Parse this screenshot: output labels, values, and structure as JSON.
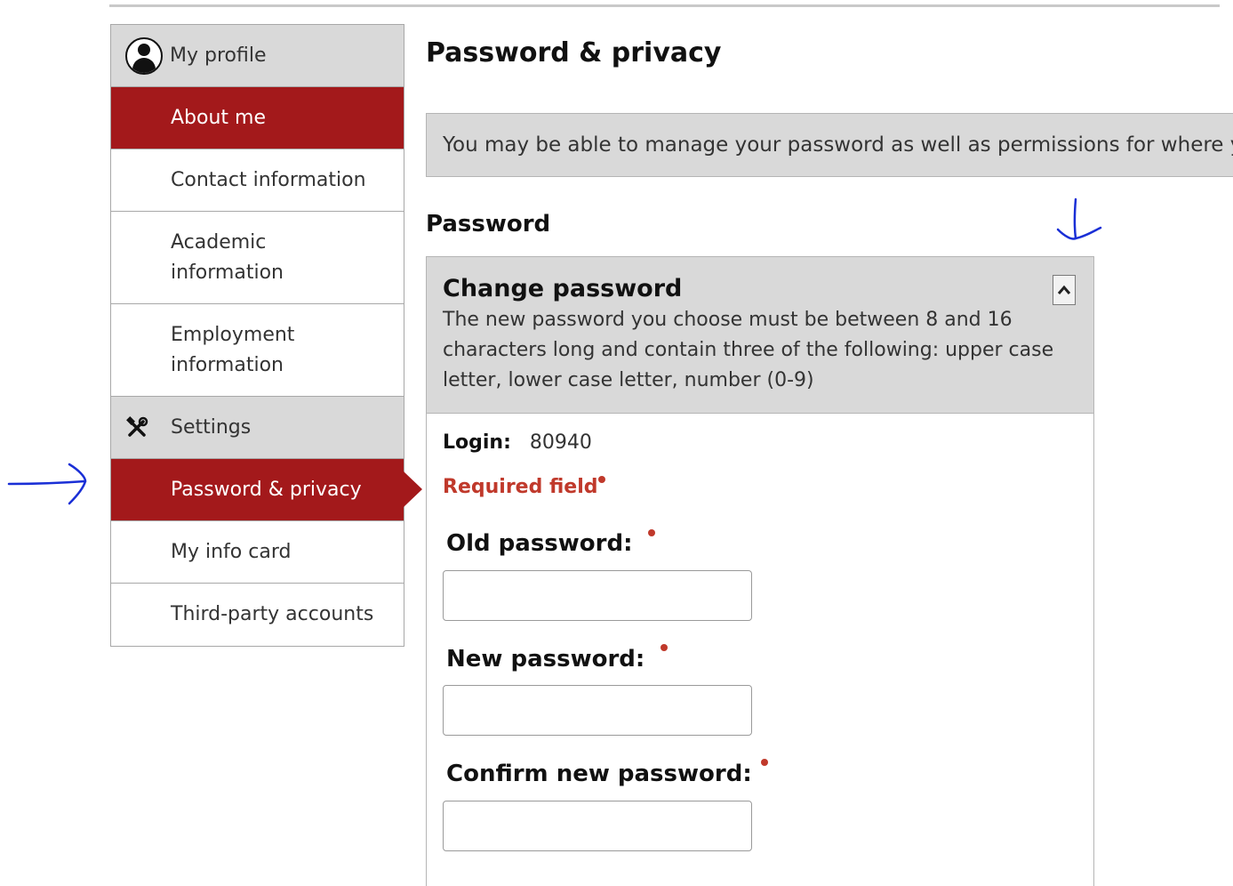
{
  "sidebar": {
    "profile_label": "My profile",
    "items": [
      {
        "label": "About me"
      },
      {
        "label": "Contact information"
      },
      {
        "label": "Academic information"
      },
      {
        "label": "Employment information"
      }
    ],
    "settings_label": "Settings",
    "settings_items": [
      {
        "label": "Password & privacy"
      },
      {
        "label": "My info card"
      },
      {
        "label": "Third-party accounts"
      }
    ]
  },
  "main": {
    "title": "Password & privacy",
    "banner": "You may be able to manage your password as well as permissions for where yo",
    "section_heading": "Password",
    "panel": {
      "title": "Change password",
      "description": "The new password you choose must be between 8 and 16 characters long and contain three of the following: upper case letter, lower case letter, number (0-9)",
      "login_label": "Login:",
      "login_value": "80940",
      "required_note": "Required field",
      "fields": [
        {
          "label": "Old password:",
          "value": ""
        },
        {
          "label": "New password:",
          "value": ""
        },
        {
          "label": "Confirm new password:",
          "value": ""
        }
      ]
    }
  },
  "colors": {
    "accent": "#a3191b",
    "header_gray": "#d9d9d9",
    "required_red": "#c0392b",
    "annotation_blue": "#1a2fd6"
  },
  "icons": {
    "profile": "user-circle-icon",
    "settings": "tools-icon",
    "collapse": "chevron-up-icon"
  }
}
